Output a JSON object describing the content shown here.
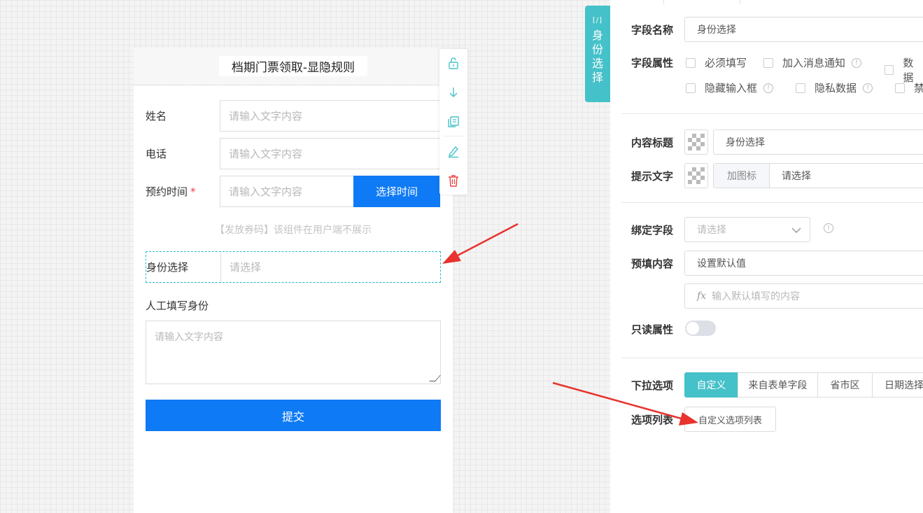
{
  "form": {
    "title": "档期门票领取-显隐规则",
    "fields": {
      "name": {
        "label": "姓名",
        "placeholder": "请输入文字内容"
      },
      "phone": {
        "label": "电话",
        "placeholder": "请输入文字内容"
      },
      "appointment": {
        "label": "预约时间",
        "required_mark": "*",
        "placeholder": "请输入文字内容",
        "button": "选择时间"
      }
    },
    "notice": "【发放券码】该组件在用户端不展示",
    "identity": {
      "label": "身份选择",
      "placeholder": "请选择"
    },
    "manual": {
      "label": "人工填写身份",
      "placeholder": "请输入文字内容"
    },
    "submit": "提交"
  },
  "side_tab": {
    "code": "[/]",
    "chars": [
      "身",
      "份",
      "选",
      "择"
    ]
  },
  "panel": {
    "field_name": {
      "label": "字段名称",
      "value": "身份选择"
    },
    "field_attr": {
      "label": "字段属性",
      "options": [
        "必须填写",
        "加入消息通知",
        "数据",
        "隐藏输入框",
        "隐私数据",
        "禁"
      ]
    },
    "content_title": {
      "label": "内容标题",
      "value": "身份选择"
    },
    "hint_text": {
      "label": "提示文字",
      "addon": "加图标",
      "value": "请选择"
    },
    "bind_field": {
      "label": "绑定字段",
      "placeholder": "请选择"
    },
    "prefill": {
      "label": "预填内容",
      "value": "设置默认值",
      "fx": "fx",
      "fx_placeholder": "输入默认填写的内容"
    },
    "readonly": {
      "label": "只读属性",
      "on": false
    },
    "dropdown": {
      "label": "下拉选项",
      "segments": [
        "自定义",
        "来自表单字段",
        "省市区",
        "日期选择"
      ],
      "active": 0
    },
    "option_list": {
      "label": "选项列表",
      "button": "自定义选项列表"
    }
  },
  "colors": {
    "primary": "#0f7af5",
    "accent": "#45c1c9",
    "arrow": "#e8332f",
    "danger": "#f04040"
  }
}
